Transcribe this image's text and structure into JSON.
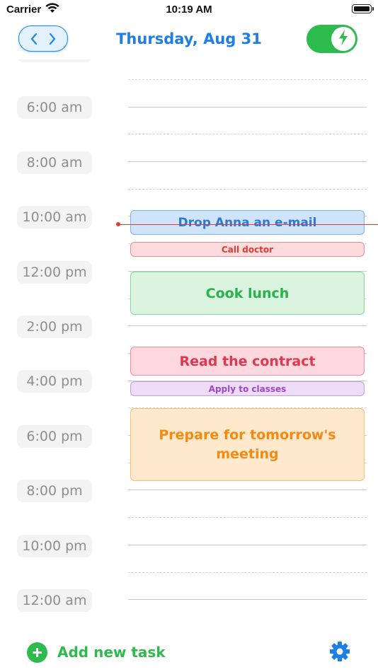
{
  "status_bar": {
    "carrier": "Carrier",
    "time": "10:19 AM",
    "icons": [
      "wifi-icon",
      "battery-icon"
    ]
  },
  "header": {
    "prev_icon": "chevron-left-icon",
    "next_icon": "chevron-right-icon",
    "date": "Thursday, Aug 31",
    "toggle_on": true,
    "toggle_icon": "lightning-bolt-icon",
    "accent_color": "#1e7ee4",
    "toggle_color": "#2dbb4e"
  },
  "timeline": {
    "time_labels": [
      "6:00 am",
      "8:00 am",
      "10:00 am",
      "12:00 pm",
      "2:00 pm",
      "4:00 pm",
      "6:00 pm",
      "8:00 pm",
      "10:00 pm",
      "12:00 am"
    ],
    "current_time_color": "#e53935"
  },
  "tasks": [
    {
      "title": "Drop Anna an e-mail",
      "color": "blue"
    },
    {
      "title": "Call doctor",
      "color": "red"
    },
    {
      "title": "Cook lunch",
      "color": "green"
    },
    {
      "title": "Read the contract",
      "color": "pink"
    },
    {
      "title": "Apply to classes",
      "color": "purple"
    },
    {
      "title": "Prepare for tomorrow's meeting",
      "color": "orange"
    }
  ],
  "footer": {
    "add_label": "Add new task",
    "add_icon": "plus-circle-icon",
    "settings_icon": "gear-icon"
  }
}
